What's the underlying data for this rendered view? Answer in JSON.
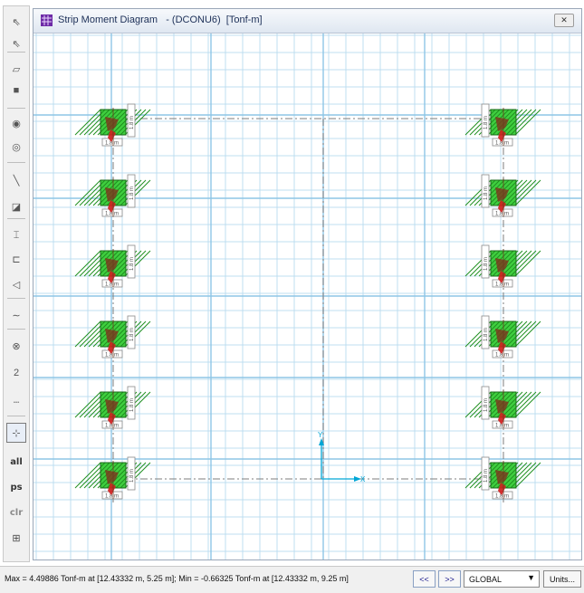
{
  "window": {
    "title": "Strip Moment Diagram   - (DCONU6)  [Tonf-m]",
    "close_label": "✕"
  },
  "toolbar": {
    "items": [
      {
        "icon": "pointer-icon",
        "glyph": "⇖"
      },
      {
        "icon": "reshape-pointer-icon",
        "glyph": "⇖"
      },
      {
        "icon": "draw-area-icon",
        "glyph": "▱"
      },
      {
        "icon": "draw-rectangle-icon",
        "glyph": "■"
      },
      {
        "icon": "draw-point-icon",
        "glyph": "◉"
      },
      {
        "icon": "draw-column-icon",
        "glyph": "◎"
      },
      {
        "icon": "draw-line-icon",
        "glyph": "╲"
      },
      {
        "icon": "draw-beam-icon",
        "glyph": "◪"
      },
      {
        "icon": "draw-wall-icon",
        "glyph": "⌶"
      },
      {
        "icon": "draw-frame-icon",
        "glyph": "⊏"
      },
      {
        "icon": "draw-slope-icon",
        "glyph": "◁"
      },
      {
        "icon": "draw-tendon-icon",
        "glyph": "∼"
      },
      {
        "icon": "draw-node-icon",
        "glyph": "⊗"
      },
      {
        "icon": "dimension-icon",
        "glyph": "2"
      },
      {
        "icon": "draw-dashed-line-icon",
        "glyph": "┄"
      },
      {
        "icon": "snap-icon",
        "glyph": "⊹"
      }
    ],
    "select_all": "all",
    "select_previous": "ps",
    "clear_selection": "clr",
    "grid_snap_icon": "grid-snap-icon"
  },
  "labels": {
    "column_width": "1.8 m",
    "axis_x": "X",
    "axis_y": "Y"
  },
  "status": {
    "text": "Max = 4.49886 Tonf-m at [12.43332 m, 5.25 m];  Min = -0.66325 Tonf-m at [12.43332 m, 9.25 m]",
    "prev_label": "<<",
    "next_label": ">>",
    "coord_system": "GLOBAL",
    "units_label": "Units..."
  },
  "colors": {
    "grid": "#b9dcef",
    "accent": "#00a6d6",
    "title_text": "#1c2f57",
    "column_fill": "#3fcf3f",
    "moment_positive": "#7a3b1f",
    "moment_negative": "#d11d1d"
  }
}
